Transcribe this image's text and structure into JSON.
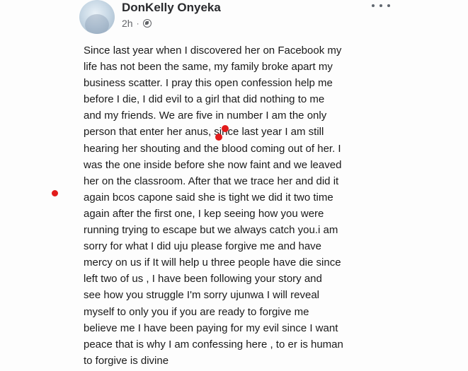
{
  "post": {
    "author": "DonKelly Onyeka",
    "time": "2h",
    "separator": "·",
    "privacy_icon": "globe-icon",
    "menu_icon": "more-horizontal-icon",
    "body_lines": [
      "Since last year when I discovered her on Facebook my",
      "life has not been the same, my family broke apart my",
      "business scatter. I pray this open confession help me",
      "before I die, I did evil to a girl that did nothing to me",
      "and my friends. We are five in number I am the only",
      "person that enter her anus, since last year I am still",
      "hearing her shouting and the blood coming out of her. I",
      "was the one inside before she now faint and we leaved",
      "her on the classroom. After that we trace her and did it",
      "again bcos capone said she is tight we did it two time",
      "again after the first one, I kep seeing how you were",
      "running trying to escape but we always catch you.i am",
      "sorry for what I did uju please forgive me and have",
      "mercy on us if It will help u three people have die since",
      "left two of us , I have been following your story and",
      "see how you struggle I'm sorry ujunwa I will reveal",
      "myself to only you if you are ready to forgive me",
      "believe me I have been paying for my evil since I want",
      "peace that is why I am confessing here , to er is human",
      "to forgive is divine"
    ]
  },
  "colors": {
    "annotation_dot": "#e21b1b",
    "meta_text": "#65676b"
  }
}
